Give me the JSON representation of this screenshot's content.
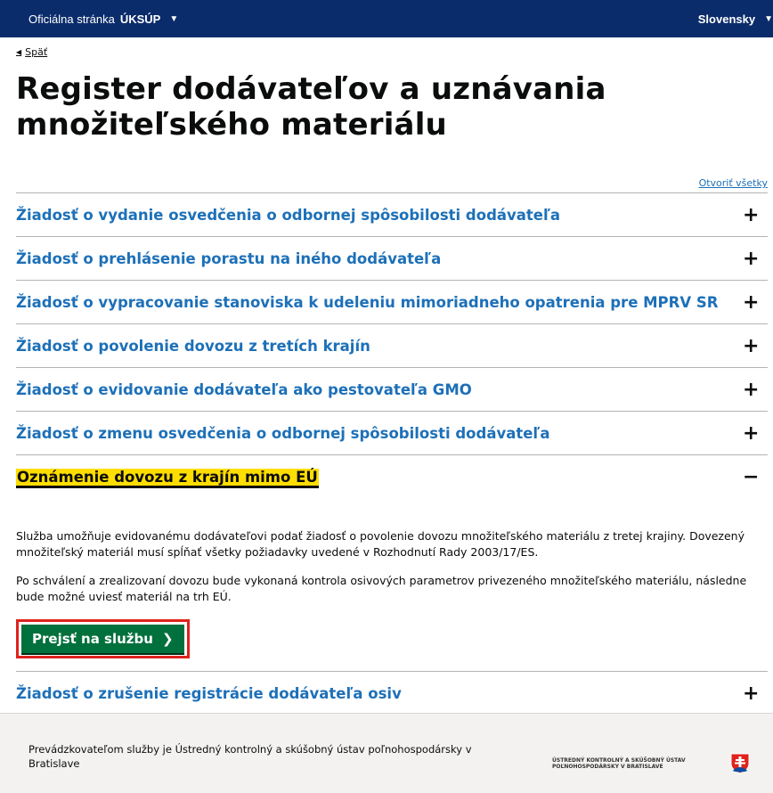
{
  "topbar": {
    "official_prefix": "Oficiálna stránka",
    "official_brand": "ÚKSÚP",
    "language": "Slovensky"
  },
  "back_link": "Späť",
  "page_title": "Register dodávateľov a uznávania množiteľského materiálu",
  "open_all": "Otvoriť všetky",
  "accordion": [
    {
      "title": "Žiadosť o vydanie osvedčenia o odbornej spôsobilosti dodávateľa",
      "toggle": "+"
    },
    {
      "title": "Žiadosť o prehlásenie porastu na iného dodávateľa",
      "toggle": "+"
    },
    {
      "title": "Žiadosť o vypracovanie stanoviska k udeleniu mimoriadneho opatrenia pre MPRV SR",
      "toggle": "+"
    },
    {
      "title": "Žiadosť o povolenie dovozu z tretích krajín",
      "toggle": "+"
    },
    {
      "title": "Žiadosť o evidovanie dodávateľa ako pestovateľa GMO",
      "toggle": "+"
    },
    {
      "title": "Žiadosť o zmenu osvedčenia o odbornej spôsobilosti dodávateľa",
      "toggle": "+"
    },
    {
      "title": "Oznámenie dovozu z krajín mimo EÚ",
      "toggle": "−",
      "paragraph1": "Služba umožňuje evidovanému dodávateľovi podať žiadosť o povolenie dovozu množiteľského materiálu z tretej krajiny. Dovezený množiteľský materiál musí spĺňať všetky požiadavky uvedené v Rozhodnutí Rady 2003/17/ES.",
      "paragraph2": "Po schválení a zrealizovaní dovozu bude vykonaná kontrola osivových parametrov privezeného množiteľského materiálu, následne bude možné uviesť materiál na trh EÚ.",
      "cta_label": "Prejsť na službu"
    },
    {
      "title": "Žiadosť o zrušenie registrácie dodávateľa osiv",
      "toggle": "+"
    }
  ],
  "footer": {
    "operator_text": "Prevádzkovateľom služby je Ústredný kontrolný a skúšobný ústav poľnohospodársky v Bratislave",
    "logo_line1": "ÚSTREDNÝ KONTROLNÝ A SKÚŠOBNÝ ÚSTAV",
    "logo_line2": "POĽNOHOSPODÁRSKY V BRATISLAVE"
  },
  "colors": {
    "topbar": "#0b2c6b",
    "link": "#1d70b8",
    "focus_yellow": "#ffdd00",
    "cta_green": "#00703c",
    "highlight_red": "#e0221c"
  }
}
